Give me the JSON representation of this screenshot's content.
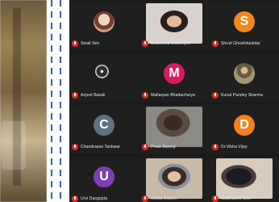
{
  "participants": [
    {
      "name": "Swati Sen",
      "type": "photo",
      "bg": "#c8a07f"
    },
    {
      "name": "Sudeshna Mukherjee",
      "type": "video",
      "bg": "#cfc6c0"
    },
    {
      "name": "Shruti Ghoshdastidar",
      "type": "letter",
      "letter": "S",
      "color": "#f0881a"
    },
    {
      "name": "Arijeet Basak",
      "type": "photo",
      "bg": "#2d2d2d"
    },
    {
      "name": "Mallarpan Bhattacharya",
      "type": "letter",
      "letter": "M",
      "color": "#d81b60"
    },
    {
      "name": "Kunal Pandey Sharma",
      "type": "photo",
      "bg": "#8a7d62"
    },
    {
      "name": "Chandrasee Tankwar",
      "type": "letter",
      "letter": "C",
      "color": "#5f7280"
    },
    {
      "name": "Pinak Banerji",
      "type": "video",
      "bg": "#6f6e6a"
    },
    {
      "name": "Dr.Vibha Vijay",
      "type": "letter",
      "letter": "D",
      "color": "#f4811f"
    },
    {
      "name": "Urvi Dasgupta",
      "type": "letter",
      "letter": "U",
      "color": "#7b3fb6"
    },
    {
      "name": "Ankita Jhaveri",
      "type": "video",
      "bg": "#bfae9d"
    },
    {
      "name": "Madhusree Sen",
      "type": "video",
      "bg": "#c9bcb0"
    }
  ],
  "colors": {
    "grid_background": "#1b1b1c",
    "muted_mic": "#d93025"
  }
}
